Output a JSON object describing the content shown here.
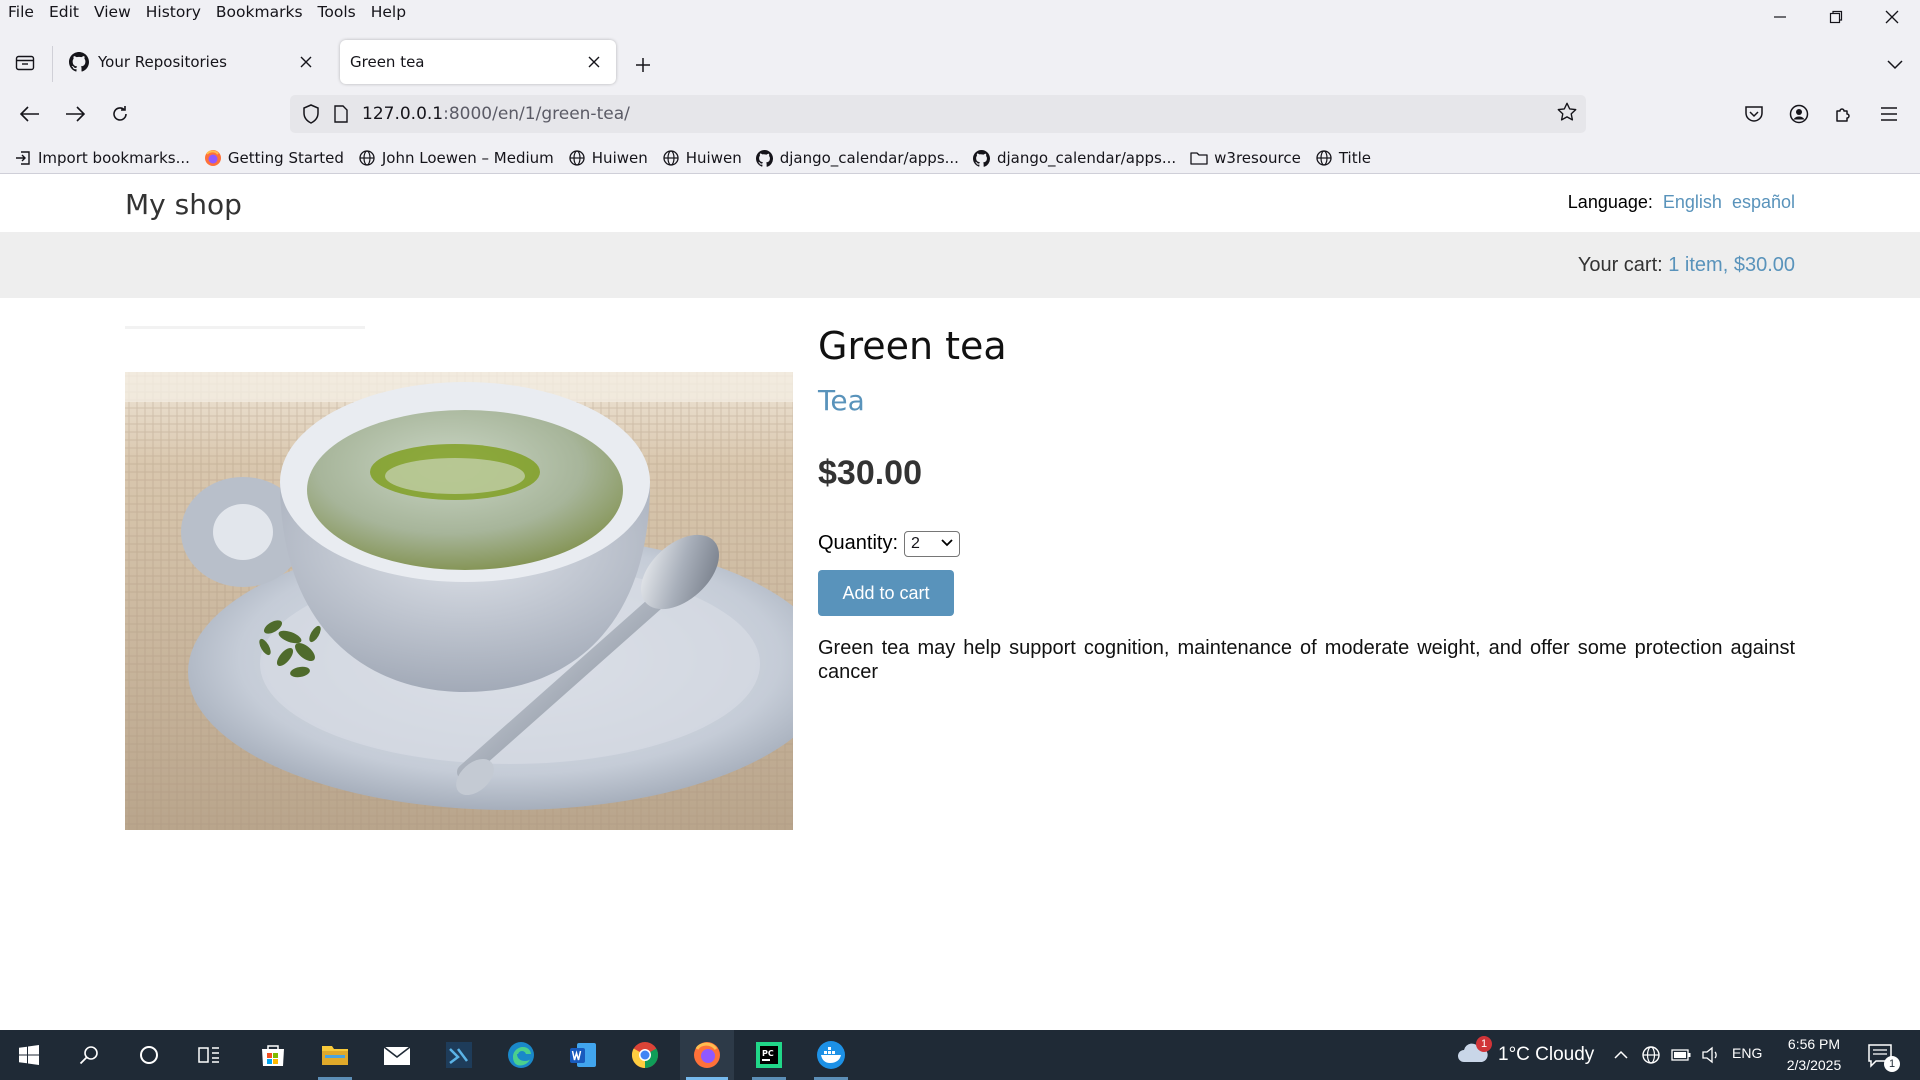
{
  "menubar": {
    "items": [
      "File",
      "Edit",
      "View",
      "History",
      "Bookmarks",
      "Tools",
      "Help"
    ]
  },
  "tabs": [
    {
      "title": "Your Repositories",
      "icon": "github-icon",
      "active": false
    },
    {
      "title": "Green tea",
      "icon": "",
      "active": true
    }
  ],
  "navbar": {
    "url_host": "127.0.0.1",
    "url_path": ":8000/en/1/green-tea/"
  },
  "bookmarks": [
    {
      "label": "Import bookmarks...",
      "icon": "import-icon"
    },
    {
      "label": "Getting Started",
      "icon": "firefox-icon"
    },
    {
      "label": "John Loewen – Medium",
      "icon": "globe-icon"
    },
    {
      "label": "Huiwen",
      "icon": "globe-icon"
    },
    {
      "label": "Huiwen",
      "icon": "globe-icon"
    },
    {
      "label": "django_calendar/apps...",
      "icon": "github-icon"
    },
    {
      "label": "django_calendar/apps...",
      "icon": "github-icon"
    },
    {
      "label": "w3resource",
      "icon": "folder-icon"
    },
    {
      "label": "Title",
      "icon": "globe-icon"
    }
  ],
  "site": {
    "logo": "My shop",
    "language_label": "Language:",
    "languages": [
      "English",
      "español"
    ],
    "cart_label": "Your cart:",
    "cart_value": "1 item, $30.00"
  },
  "product": {
    "name": "Green tea",
    "category": "Tea",
    "price": "$30.00",
    "quantity_label": "Quantity:",
    "quantity_value": "2",
    "add_button": "Add to cart",
    "description": "Green tea may help support cognition, maintenance of moderate weight, and offer some protection against cancer"
  },
  "taskbar": {
    "weather": "1°C  Cloudy",
    "weather_badge": "1",
    "language": "ENG",
    "time": "6:56 PM",
    "date": "2/3/2025",
    "notification_count": "1"
  },
  "colors": {
    "accent": "#5993bb",
    "chrome_bg": "#f0f0f4",
    "taskbar_bg": "#1f2a36",
    "subheader_bg": "#eeeeee"
  }
}
